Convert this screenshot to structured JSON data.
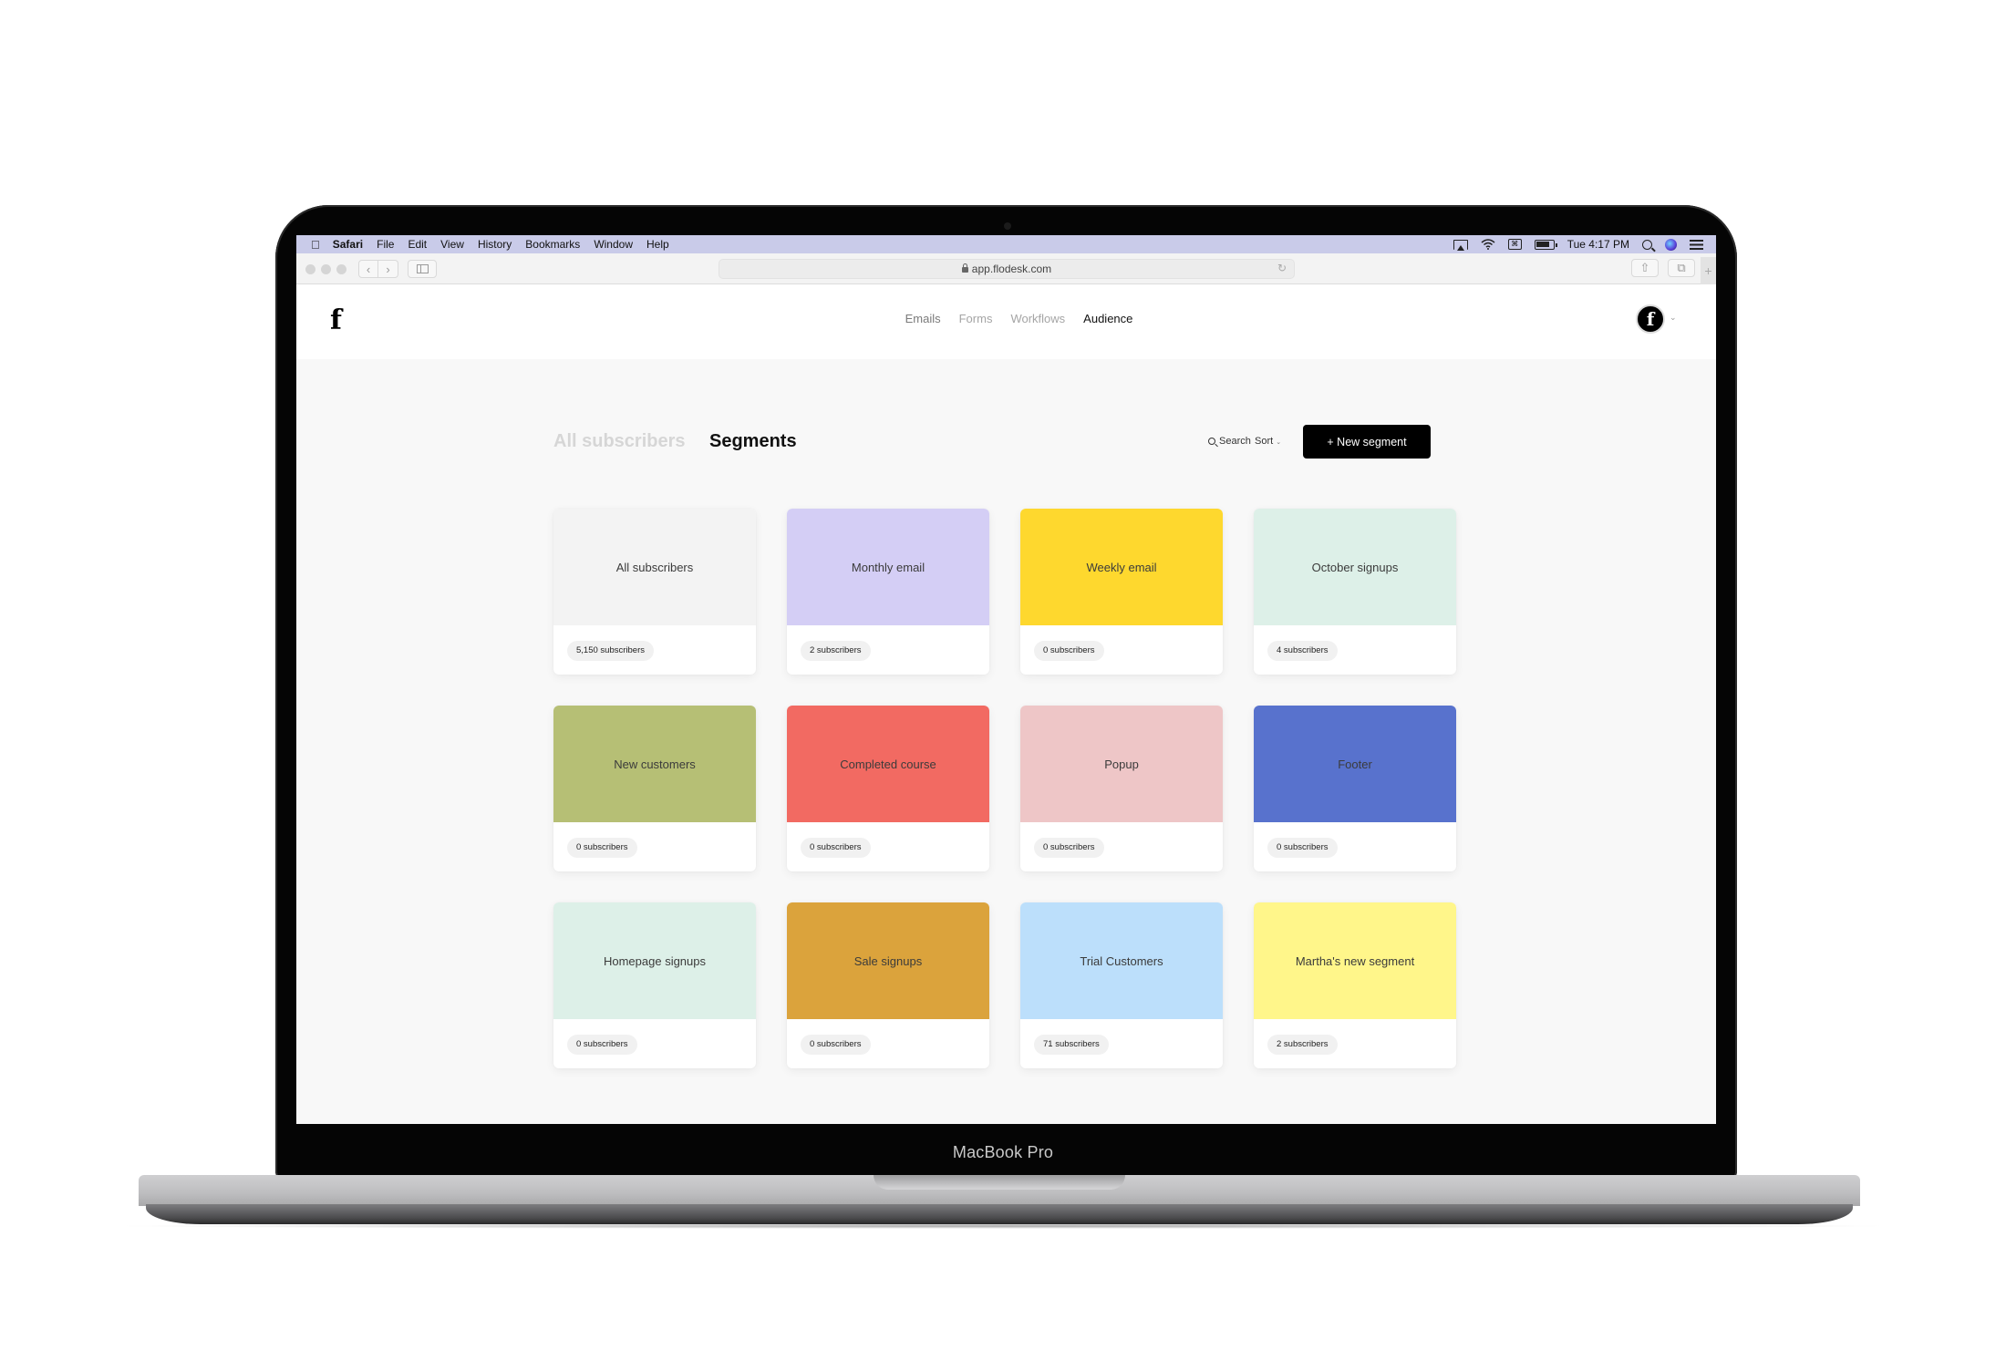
{
  "device": {
    "label": "MacBook Pro"
  },
  "menubar": {
    "app_name": "Safari",
    "items": [
      "File",
      "Edit",
      "View",
      "History",
      "Bookmarks",
      "Window",
      "Help"
    ],
    "status_icons": [
      "airplay-icon",
      "wifi-icon",
      "command-key-icon",
      "battery-icon"
    ],
    "clock": "Tue 4:17 PM"
  },
  "browser": {
    "url": "app.flodesk.com"
  },
  "app": {
    "logo": "f",
    "nav": [
      {
        "label": "Emails",
        "active": false
      },
      {
        "label": "Forms",
        "active": false
      },
      {
        "label": "Workflows",
        "active": false
      },
      {
        "label": "Audience",
        "active": true
      }
    ],
    "avatar_letter": "f"
  },
  "page": {
    "tabs": [
      {
        "label": "All subscribers",
        "active": false
      },
      {
        "label": "Segments",
        "active": true
      }
    ],
    "search_label": "Search",
    "sort_label": "Sort",
    "new_segment_label": "+ New segment",
    "accent_color": "#000000"
  },
  "segments": [
    {
      "name": "All subscribers",
      "count": "5,150 subscribers",
      "color": "#f3f3f3"
    },
    {
      "name": "Monthly email",
      "count": "2 subscribers",
      "color": "#d4cef5"
    },
    {
      "name": "Weekly email",
      "count": "0 subscribers",
      "color": "#fed82e"
    },
    {
      "name": "October signups",
      "count": "4 subscribers",
      "color": "#ddf0e8"
    },
    {
      "name": "New customers",
      "count": "0 subscribers",
      "color": "#b6bf75"
    },
    {
      "name": "Completed course",
      "count": "0 subscribers",
      "color": "#f26a62"
    },
    {
      "name": "Popup",
      "count": "0 subscribers",
      "color": "#eec6c7"
    },
    {
      "name": "Footer",
      "count": "0 subscribers",
      "color": "#5872cd"
    },
    {
      "name": "Homepage signups",
      "count": "0 subscribers",
      "color": "#ddf0e8"
    },
    {
      "name": "Sale signups",
      "count": "0 subscribers",
      "color": "#dba33c"
    },
    {
      "name": "Trial Customers",
      "count": "71 subscribers",
      "color": "#bcdffb"
    },
    {
      "name": "Martha's new segment",
      "count": "2 subscribers",
      "color": "#fff68a"
    }
  ]
}
